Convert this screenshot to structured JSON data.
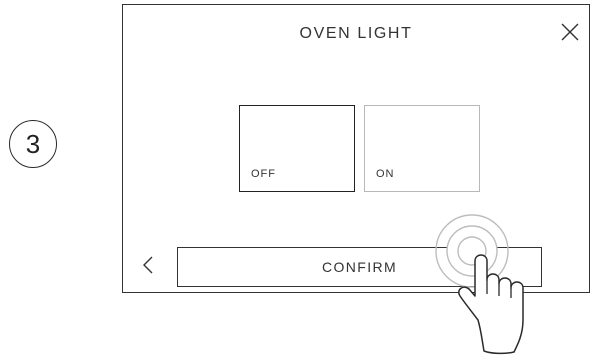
{
  "step": {
    "number": "3"
  },
  "screen": {
    "title": "OVEN LIGHT",
    "options": [
      {
        "label": "OFF",
        "selected": true
      },
      {
        "label": "ON",
        "selected": false
      }
    ],
    "confirm_label": "CONFIRM"
  },
  "icons": {
    "close": "close-icon",
    "back": "chevron-left-icon",
    "hand": "tap-hand-icon"
  },
  "colors": {
    "border_selected": "#222222",
    "border_unselected": "#b8b8b8",
    "text": "#333333"
  }
}
